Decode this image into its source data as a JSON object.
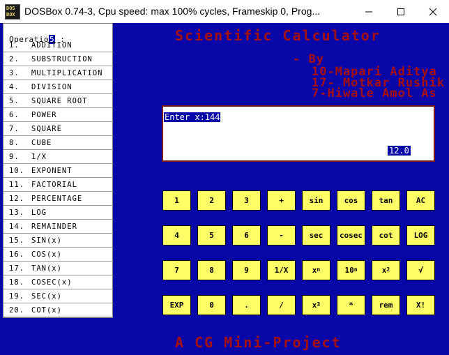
{
  "window": {
    "title": "DOSBox 0.74-3, Cpu speed: max 100% cycles, Frameskip  0, Prog...",
    "icon_text": [
      "DOS",
      "BOX"
    ],
    "controls": [
      "minimize-icon",
      "maximize-icon",
      "close-icon"
    ]
  },
  "sidebar": {
    "label_prefix": "Operatio",
    "label_cursor": "5",
    "label_suffix": " :",
    "items": [
      {
        "num": "1.",
        "label": "ADDITION"
      },
      {
        "num": "2.",
        "label": "SUBSTRUCTION"
      },
      {
        "num": "3.",
        "label": "MULTIPLICATION"
      },
      {
        "num": "4.",
        "label": "DIVISION"
      },
      {
        "num": "5.",
        "label": "SQUARE ROOT"
      },
      {
        "num": "6.",
        "label": "POWER"
      },
      {
        "num": "7.",
        "label": "SQUARE"
      },
      {
        "num": "8.",
        "label": "CUBE"
      },
      {
        "num": "9.",
        "label": "1/X"
      },
      {
        "num": "10.",
        "label": "EXPONENT"
      },
      {
        "num": "11.",
        "label": "FACTORIAL"
      },
      {
        "num": "12.",
        "label": "PERCENTAGE"
      },
      {
        "num": "13.",
        "label": "LOG"
      },
      {
        "num": "14.",
        "label": "REMAINDER"
      },
      {
        "num": "15.",
        "label": "SIN(x)"
      },
      {
        "num": "16.",
        "label": "COS(x)"
      },
      {
        "num": "17.",
        "label": "TAN(x)"
      },
      {
        "num": "18.",
        "label": "COSEC(x)"
      },
      {
        "num": "19.",
        "label": "SEC(x)"
      },
      {
        "num": "20.",
        "label": "COT(x)"
      }
    ]
  },
  "header": {
    "title": "Scientific Calculator",
    "by": "- By",
    "authors": [
      "10-Mapari Aditya",
      "17- Motkar Rushik",
      "7-Hiwale  Amol As"
    ]
  },
  "display": {
    "input": "Enter x:144",
    "result": "12.0"
  },
  "keypad": {
    "rows": [
      [
        {
          "t": "1"
        },
        {
          "t": "2"
        },
        {
          "t": "3"
        },
        {
          "t": "+"
        },
        {
          "t": "sin"
        },
        {
          "t": "cos"
        },
        {
          "t": "tan"
        },
        {
          "t": "AC"
        }
      ],
      [
        {
          "t": "4"
        },
        {
          "t": "5"
        },
        {
          "t": "6"
        },
        {
          "t": "-"
        },
        {
          "t": "sec"
        },
        {
          "t": "cosec"
        },
        {
          "t": "cot"
        },
        {
          "t": "LOG"
        }
      ],
      [
        {
          "t": "7"
        },
        {
          "t": "8"
        },
        {
          "t": "9"
        },
        {
          "t": "1/X"
        },
        {
          "t": "x",
          "s": "n"
        },
        {
          "t": "10",
          "s": "n"
        },
        {
          "t": "x",
          "s": "2"
        },
        {
          "t": "√"
        }
      ],
      [
        {
          "t": "EXP"
        },
        {
          "t": "0"
        },
        {
          "t": "."
        },
        {
          "t": "/"
        },
        {
          "t": "x",
          "s": "3"
        },
        {
          "t": "*"
        },
        {
          "t": "rem"
        },
        {
          "t": "X!"
        }
      ]
    ]
  },
  "footer": "A CG Mini-Project",
  "colors": {
    "background": "#0707a8",
    "accent_red": "#a61010",
    "key_yellow": "#ffff66"
  }
}
